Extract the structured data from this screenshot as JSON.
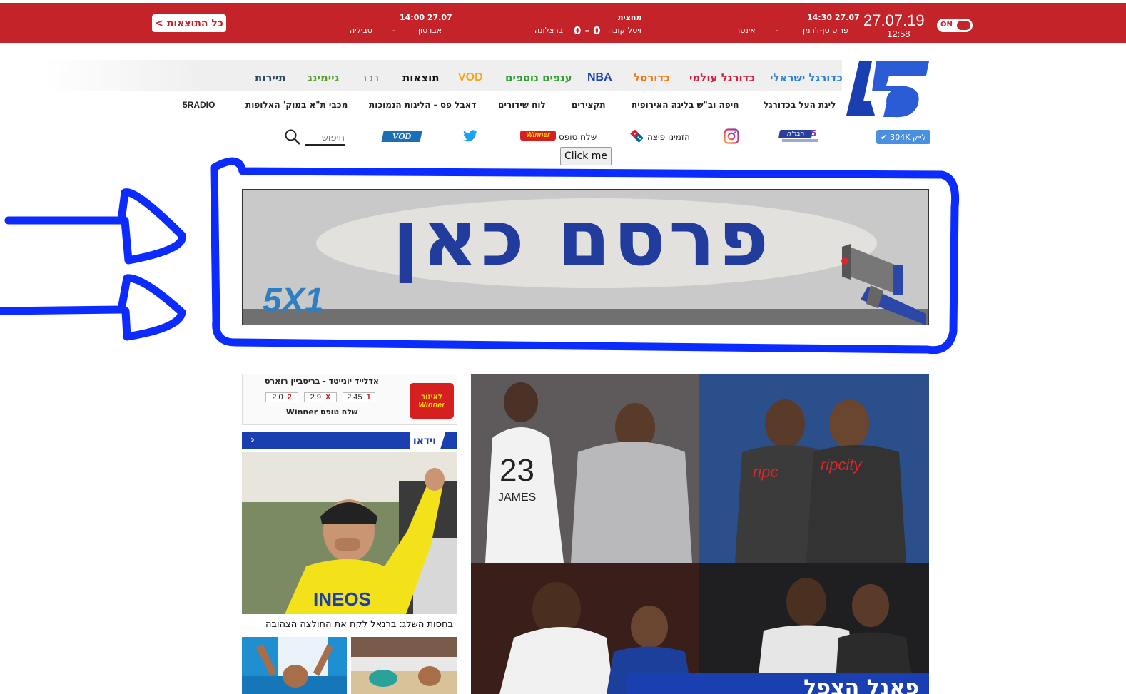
{
  "scores_bar": {
    "all_results_label": "כל התוצאות >",
    "date": "27.07.19",
    "time": "12:58",
    "live_toggle": "ON",
    "matches": [
      {
        "time": "27.07 14:30",
        "home": "פריס סן-ז'רמן",
        "score": "-",
        "away": "אינטר"
      },
      {
        "time": "מחצית",
        "home": "ויסל קובה",
        "score": "0 - 0",
        "away": "ברצלונה"
      },
      {
        "time": "27.07 14:00",
        "home": "אברטון",
        "score": "-",
        "away": "סביליה"
      }
    ]
  },
  "main_nav": {
    "items": [
      {
        "label": "כדורגל ישראלי",
        "color": "#2b7fd6"
      },
      {
        "label": "כדורגל עולמי",
        "color": "#d1203e"
      },
      {
        "label": "כדורסל",
        "color": "#f07a12"
      },
      {
        "label": "NBA",
        "color": "#1a3fb0"
      },
      {
        "label": "ענפים נוספים",
        "color": "#2e9e2e"
      },
      {
        "label": "VOD",
        "color": "#f0a81e"
      },
      {
        "label": "תוצאות",
        "color": "#111111"
      },
      {
        "label": "רכב",
        "color": "#777777"
      },
      {
        "label": "גיימינג",
        "color": "#5aa02c"
      },
      {
        "label": "תיירות",
        "color": "#2a4a5a"
      }
    ]
  },
  "sub_nav": {
    "items": [
      "ליגת העל בכדורגל",
      "חיפה וב\"ש בליגה האירופית",
      "תקצירים",
      "לוח שידורים",
      "דאבל פס - הליגות הנמוכות",
      "מכבי ת\"א במוק' האלופות",
      "5RADIO"
    ]
  },
  "utility_row": {
    "like_label": "לייק 304K",
    "pizza_label": "הזמינו פיצה",
    "toto_label": "שלח טופס",
    "winner_badge": "Winner",
    "vod_badge": "VOD",
    "search_placeholder": "חיפוש",
    "click_me": "Click me",
    "chevra_badge": "חבר'ה"
  },
  "ad_banner": {
    "text": "פרסם כאן",
    "brand": "5X1"
  },
  "bet_widget": {
    "match": "אדלייד יונייטד - בריסביין רוארס",
    "odds": [
      {
        "label": "1",
        "value": "2.45"
      },
      {
        "label": "X",
        "value": "2.9"
      },
      {
        "label": "2",
        "value": "2.0"
      }
    ],
    "send_label": "שלח טופס Winner",
    "logo_top": "לאיזור",
    "logo_bottom": "Winner"
  },
  "video_section": {
    "title": "וידאו",
    "caption": "בחסות השלג: ברנאל לקח את החולצה הצהובה"
  },
  "hero": {
    "caption": "פאנל הצפל"
  },
  "colors": {
    "top_bar": "#c4232a",
    "brand_blue": "#1a3fb0",
    "annotation_blue": "#0b2bff"
  }
}
